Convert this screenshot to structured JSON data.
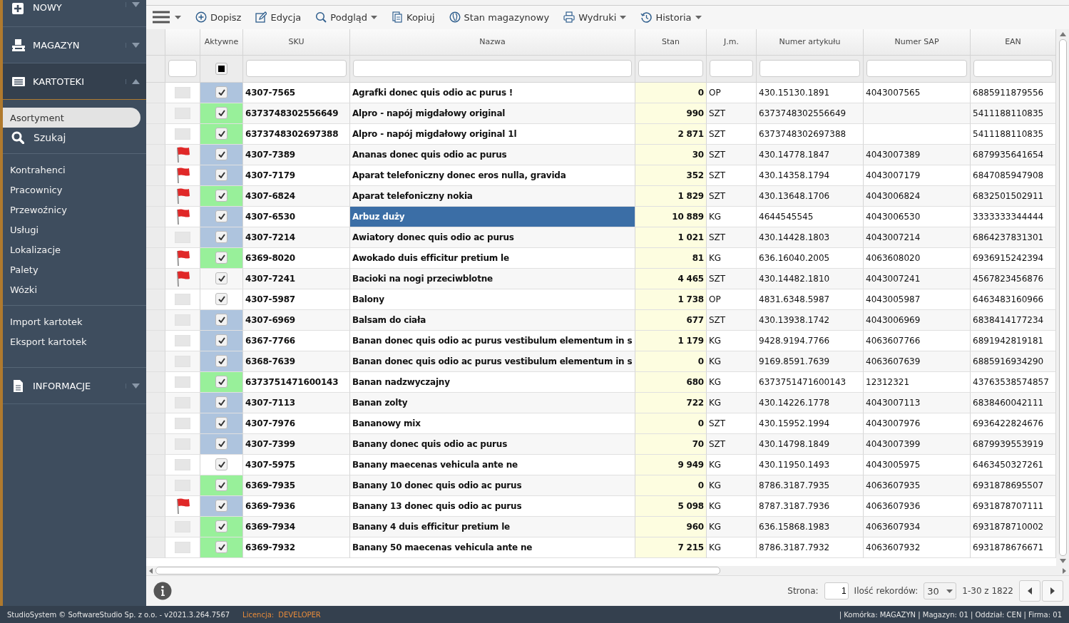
{
  "sidebar": {
    "sections": [
      {
        "label": "NOWY",
        "expanded": false
      },
      {
        "label": "MAGAZYN",
        "expanded": false
      },
      {
        "label": "KARTOTEKI",
        "expanded": true,
        "groups": [
          [
            {
              "label": "Asortyment",
              "selected": true,
              "kind": "plain"
            },
            {
              "label": "Szukaj",
              "selected": false,
              "kind": "search"
            }
          ],
          [
            {
              "label": "Kontrahenci",
              "selected": false,
              "kind": "plain"
            },
            {
              "label": "Pracownicy",
              "selected": false,
              "kind": "plain"
            },
            {
              "label": "Przewoźnicy",
              "selected": false,
              "kind": "plain"
            },
            {
              "label": "Usługi",
              "selected": false,
              "kind": "plain"
            },
            {
              "label": "Lokalizacje",
              "selected": false,
              "kind": "plain"
            },
            {
              "label": "Palety",
              "selected": false,
              "kind": "plain"
            },
            {
              "label": "Wózki",
              "selected": false,
              "kind": "plain"
            }
          ],
          [
            {
              "label": "Import kartotek",
              "selected": false,
              "kind": "plain"
            },
            {
              "label": "Eksport kartotek",
              "selected": false,
              "kind": "plain"
            }
          ]
        ]
      },
      {
        "label": "INFORMACJE",
        "expanded": false
      }
    ]
  },
  "toolbar": {
    "buttons": [
      {
        "label": "Dopisz",
        "dropdown": false
      },
      {
        "label": "Edycja",
        "dropdown": false
      },
      {
        "label": "Podgląd",
        "dropdown": true
      },
      {
        "label": "Kopiuj",
        "dropdown": false
      },
      {
        "label": "Stan magazynowy",
        "dropdown": false
      },
      {
        "label": "Wydruki",
        "dropdown": true
      },
      {
        "label": "Historia",
        "dropdown": true
      }
    ]
  },
  "table": {
    "columns": [
      {
        "kind": "flag"
      },
      {
        "label": "Aktywne",
        "kind": "check",
        "filter_checked": true
      },
      {
        "label": "SKU",
        "kind": "text"
      },
      {
        "label": "Nazwa",
        "kind": "text"
      },
      {
        "label": "Stan",
        "kind": "text"
      },
      {
        "label": "J.m.",
        "kind": "text"
      },
      {
        "label": "Numer artykułu",
        "kind": "text"
      },
      {
        "label": "Numer SAP",
        "kind": "text"
      },
      {
        "label": "EAN",
        "kind": "text"
      }
    ],
    "rows": [
      {
        "flag": false,
        "color": "#aec4de",
        "active": true,
        "sku": "4307-7565",
        "name": "Agrafki donec quis odio ac purus !",
        "stock": "0",
        "unit": "OP",
        "article": "430.15130.1891",
        "sap": "4043007565",
        "ean": "6885911879556",
        "selected": false
      },
      {
        "flag": false,
        "color": "#98f09a",
        "active": true,
        "sku": "6373748302556649",
        "name": "Alpro - napój migdałowy original",
        "stock": "990",
        "unit": "SZT",
        "article": "6373748302556649",
        "ean": "5411188110835",
        "selected": false
      },
      {
        "flag": false,
        "color": "#98f09a",
        "active": true,
        "sku": "6373748302697388",
        "name": "Alpro - napój migdałowy original 1l",
        "stock": "2 871",
        "unit": "SZT",
        "article": "6373748302697388",
        "ean": "5411188110835",
        "selected": false
      },
      {
        "flag": true,
        "color": "#aec4de",
        "active": true,
        "sku": "4307-7389",
        "name": "Ananas donec quis odio ac purus",
        "stock": "30",
        "unit": "SZT",
        "article": "430.14778.1847",
        "sap": "4043007389",
        "ean": "6879935641654",
        "selected": false
      },
      {
        "flag": true,
        "color": "#aec4de",
        "active": true,
        "sku": "4307-7179",
        "name": "Aparat telefoniczny donec eros nulla, gravida",
        "stock": "352",
        "unit": "SZT",
        "article": "430.14358.1794",
        "sap": "4043007179",
        "ean": "6847085947908",
        "selected": false
      },
      {
        "flag": true,
        "color": "#98f09a",
        "active": true,
        "sku": "4307-6824",
        "name": "Aparat telefoniczny nokia",
        "stock": "1 829",
        "unit": "SZT",
        "article": "430.13648.1706",
        "sap": "4043006824",
        "ean": "6832501502911",
        "selected": false
      },
      {
        "flag": true,
        "color": "#aec4de",
        "active": true,
        "sku": "4307-6530",
        "name": "Arbuz duży",
        "stock": "10 889",
        "unit": "KG",
        "article": "4644545545",
        "sap": "4043006530",
        "ean": "3333333344444",
        "selected": true
      },
      {
        "flag": false,
        "color": "#aec4de",
        "active": true,
        "sku": "4307-7214",
        "name": "Awiatory donec quis odio ac purus",
        "stock": "1 021",
        "unit": "SZT",
        "article": "430.14428.1803",
        "sap": "4043007214",
        "ean": "6864237831301",
        "selected": false
      },
      {
        "flag": true,
        "color": "#98f09a",
        "active": true,
        "sku": "6369-8020",
        "name": "Awokado duis efficitur pretium le",
        "stock": "81",
        "unit": "KG",
        "article": "636.16040.2005",
        "sap": "4063608020",
        "ean": "6936915242394",
        "selected": false
      },
      {
        "flag": true,
        "active": true,
        "sku": "4307-7241",
        "name": "Bacioki na nogi przeciwblotne",
        "stock": "4 465",
        "unit": "SZT",
        "article": "430.14482.1810",
        "sap": "4043007241",
        "ean": "4567823456876",
        "selected": false
      },
      {
        "flag": false,
        "active": true,
        "sku": "4307-5987",
        "name": "Balony",
        "stock": "1 738",
        "unit": "OP",
        "article": "4831.6348.5987",
        "sap": "4043005987",
        "ean": "6463483160966",
        "selected": false
      },
      {
        "flag": false,
        "color": "#aec4de",
        "active": true,
        "sku": "4307-6969",
        "name": "Balsam do ciała",
        "stock": "677",
        "unit": "SZT",
        "article": "430.13938.1742",
        "sap": "4043006969",
        "ean": "6838414177234",
        "selected": false
      },
      {
        "flag": false,
        "color": "#aec4de",
        "active": true,
        "sku": "6367-7766",
        "name": "Banan donec quis odio ac purus vestibulum elementum in s",
        "stock": "1 179",
        "unit": "KG",
        "article": "9428.9194.7766",
        "sap": "4063607766",
        "ean": "6891942819181",
        "selected": false
      },
      {
        "flag": false,
        "color": "#aec4de",
        "active": true,
        "sku": "6368-7639",
        "name": "Banan donec quis odio ac purus vestibulum elementum in s",
        "stock": "0",
        "unit": "KG",
        "article": "9169.8591.7639",
        "sap": "4063607639",
        "ean": "6885916934290",
        "selected": false
      },
      {
        "flag": false,
        "color": "#98f09a",
        "active": true,
        "sku": "6373751471600143",
        "name": "Banan nadzwyczajny",
        "stock": "680",
        "unit": "KG",
        "article": "6373751471600143",
        "sap": "12312321",
        "ean": "43763538574857",
        "selected": false
      },
      {
        "flag": false,
        "color": "#aec4de",
        "active": true,
        "sku": "4307-7113",
        "name": "Banan zolty",
        "stock": "722",
        "unit": "KG",
        "article": "430.14226.1778",
        "sap": "4043007113",
        "ean": "6838460042111",
        "selected": false
      },
      {
        "flag": false,
        "color": "#aec4de",
        "active": true,
        "sku": "4307-7976",
        "name": "Bananowy mix",
        "stock": "0",
        "unit": "SZT",
        "article": "430.15952.1994",
        "sap": "4043007976",
        "ean": "6936422824676",
        "selected": false
      },
      {
        "flag": false,
        "color": "#aec4de",
        "active": true,
        "sku": "4307-7399",
        "name": "Banany donec quis odio ac purus",
        "stock": "70",
        "unit": "SZT",
        "article": "430.14798.1849",
        "sap": "4043007399",
        "ean": "6879939553919",
        "selected": false
      },
      {
        "flag": false,
        "active": true,
        "sku": "4307-5975",
        "name": "Banany maecenas vehicula ante ne",
        "stock": "9 949",
        "unit": "KG",
        "article": "430.11950.1493",
        "sap": "4043005975",
        "ean": "6463450327261",
        "selected": false
      },
      {
        "flag": false,
        "color": "#98f09a",
        "active": true,
        "sku": "6369-7935",
        "name": "Banany 10 donec quis odio ac purus",
        "stock": "0",
        "unit": "KG",
        "article": "8786.3187.7935",
        "sap": "4063607935",
        "ean": "6931878695507",
        "selected": false
      },
      {
        "flag": true,
        "color": "#aec4de",
        "active": true,
        "sku": "6369-7936",
        "name": "Banany 13 donec quis odio ac purus",
        "stock": "5 098",
        "unit": "KG",
        "article": "8787.3187.7936",
        "sap": "4063607936",
        "ean": "6931878707111",
        "selected": false
      },
      {
        "flag": false,
        "color": "#98f09a",
        "active": true,
        "sku": "6369-7934",
        "name": "Banany 4 duis efficitur pretium le",
        "stock": "960",
        "unit": "KG",
        "article": "636.15868.1983",
        "sap": "4063607934",
        "ean": "6931878710002",
        "selected": false
      },
      {
        "flag": false,
        "color": "#98f09a",
        "active": true,
        "sku": "6369-7932",
        "name": "Banany 50 maecenas vehicula ante ne",
        "stock": "7 215",
        "unit": "KG",
        "article": "8786.3187.7932",
        "sap": "4063607932",
        "ean": "6931878676671",
        "selected": false
      }
    ]
  },
  "pager": {
    "page_label": "Strona:",
    "page": "1",
    "size_label": "Ilość rekordów:",
    "size": "30",
    "range": "1-30 z 1822"
  },
  "status_bar": {
    "copyright": "StudioSystem © SoftwareStudio Sp. z o.o. - v2021.3.264.7567",
    "license_label": "Licencja:",
    "license": "DEVELOPER",
    "context": "| Komórka: MAGAZYN | Magazyn: 01 | Oddział: CEN | Firma: 01"
  }
}
